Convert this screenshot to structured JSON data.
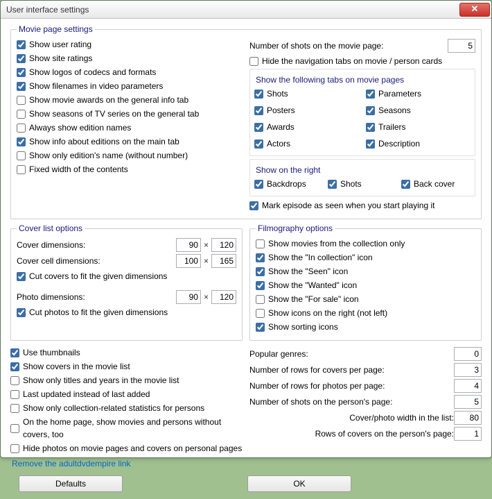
{
  "window": {
    "title": "User interface settings"
  },
  "moviePage": {
    "legend": "Movie page settings",
    "showUserRating": "Show user rating",
    "showSiteRatings": "Show site ratings",
    "showLogos": "Show logos of codecs and formats",
    "showFilenames": "Show filenames in video parameters",
    "showAwards": "Show movie awards on the general info tab",
    "showSeasons": "Show seasons of TV series on the general tab",
    "alwaysEdition": "Always show edition names",
    "editionsMainTab": "Show info about editions on the main tab",
    "editionNameOnly": "Show only edition's name (without number)",
    "fixedWidth": "Fixed width of the contents",
    "numShotsLabel": "Number of shots on the movie page:",
    "numShotsValue": "5",
    "hideNavTabs": "Hide the navigation tabs on movie / person cards",
    "tabsLegend": "Show the following tabs on movie pages",
    "tabs": {
      "shots": "Shots",
      "parameters": "Parameters",
      "posters": "Posters",
      "seasons": "Seasons",
      "awards": "Awards",
      "trailers": "Trailers",
      "actors": "Actors",
      "description": "Description"
    },
    "showRightLegend": "Show on the right",
    "right": {
      "backdrops": "Backdrops",
      "shots": "Shots",
      "backcover": "Back cover"
    },
    "markEpisode": "Mark episode as seen when you start playing it"
  },
  "coverList": {
    "legend": "Cover list options",
    "coverDimsLabel": "Cover dimensions:",
    "coverW": "90",
    "coverH": "120",
    "cellDimsLabel": "Cover cell dimensions:",
    "cellW": "100",
    "cellH": "165",
    "cutCovers": "Cut covers to fit the given dimensions",
    "photoDimsLabel": "Photo dimensions:",
    "photoW": "90",
    "photoH": "120",
    "cutPhotos": "Cut photos to fit the given dimensions"
  },
  "filmography": {
    "legend": "Filmography options",
    "collectionOnly": "Show movies from the collection only",
    "inCollectionIcon": "Show the \"In collection\" icon",
    "seenIcon": "Show the \"Seen\" icon",
    "wantedIcon": "Show the \"Wanted\" icon",
    "forSaleIcon": "Show the \"For sale\" icon",
    "iconsRight": "Show icons on the right (not left)",
    "sortingIcons": "Show sorting icons"
  },
  "bottomLeft": {
    "useThumbnails": "Use thumbnails",
    "showCovers": "Show covers in the movie list",
    "titlesYears": "Show only titles and years in the movie list",
    "lastUpdated": "Last updated instead of last added",
    "collectionStats": "Show only collection-related statistics for persons",
    "homepageNoCovers": "On the home page, show movies and persons without covers, too",
    "hidePhotos": "Hide photos on movie pages and covers on personal pages"
  },
  "bottomRight": {
    "popularGenresLabel": "Popular genres:",
    "popularGenresValue": "0",
    "rowsCoversLabel": "Number of rows for covers per page:",
    "rowsCoversValue": "3",
    "rowsPhotosLabel": "Number of rows for photos per page:",
    "rowsPhotosValue": "4",
    "shotsPersonLabel": "Number of shots on the person's page:",
    "shotsPersonValue": "5",
    "coverWidthLabel": "Cover/photo width in the list:",
    "coverWidthValue": "80",
    "rowsPersonLabel": "Rows of covers on the person's page:",
    "rowsPersonValue": "1"
  },
  "link": "Remove the adultdvdempire link",
  "buttons": {
    "defaults": "Defaults",
    "ok": "OK"
  }
}
